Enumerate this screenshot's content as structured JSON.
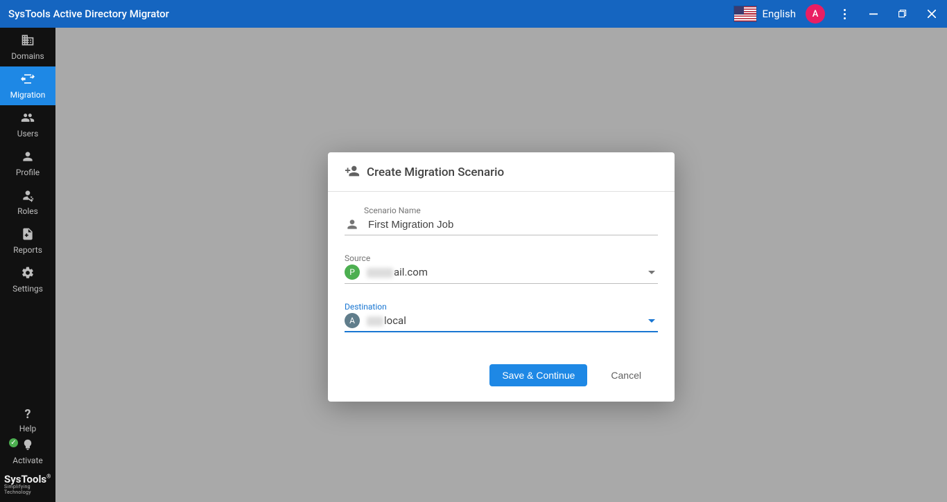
{
  "titlebar": {
    "title": "SysTools Active Directory Migrator",
    "language": "English",
    "avatar_letter": "A"
  },
  "sidebar": {
    "items": [
      {
        "id": "domains",
        "label": "Domains"
      },
      {
        "id": "migration",
        "label": "Migration"
      },
      {
        "id": "users",
        "label": "Users"
      },
      {
        "id": "profile",
        "label": "Profile"
      },
      {
        "id": "roles",
        "label": "Roles"
      },
      {
        "id": "reports",
        "label": "Reports"
      },
      {
        "id": "settings",
        "label": "Settings"
      }
    ],
    "bottom": {
      "help": "Help",
      "activate": "Activate"
    },
    "logo": {
      "name": "SysTools",
      "tagline": "Simplifying Technology"
    }
  },
  "dialog": {
    "title": "Create Migration Scenario",
    "name_label": "Scenario Name",
    "name_value": "First Migration Job",
    "source_label": "Source",
    "source_badge": "P",
    "source_badge_color": "#4caf50",
    "source_suffix": "ail.com",
    "destination_label": "Destination",
    "destination_badge": "A",
    "destination_badge_color": "#607d8b",
    "destination_suffix": "local",
    "save": "Save & Continue",
    "cancel": "Cancel"
  }
}
